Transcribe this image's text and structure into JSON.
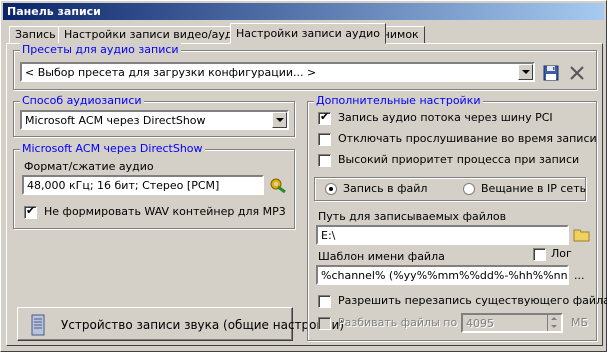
{
  "window": {
    "title": "Панель записи"
  },
  "tabs": [
    {
      "label": "Запись"
    },
    {
      "label": "Настройки записи видео/аудио"
    },
    {
      "label": "Настройки записи аудио"
    },
    {
      "label": "Снимок"
    }
  ],
  "presets": {
    "group_label": "Пресеты для аудио записи",
    "selected": "< Выбор пресета для загрузки конфигурации... >"
  },
  "audio_method": {
    "group_label": "Способ аудиозаписи",
    "selected": "Microsoft ACM через DirectShow"
  },
  "acm": {
    "group_label": "Microsoft ACM через DirectShow",
    "format_label": "Формат/сжатие аудио",
    "format_value": "48,000 кГц; 16 бит; Стерео [PCM]",
    "no_wav_label": "Не формировать WAV контейнер для MP3",
    "no_wav_checked": true
  },
  "device_button": {
    "label": "Устройство записи звука (общие настройки)"
  },
  "extra": {
    "group_label": "Дополнительные настройки",
    "pci_label": "Запись аудио потока через шину PCI",
    "pci_checked": true,
    "mute_label": "Отключать прослушивание во время записи",
    "mute_checked": false,
    "priority_label": "Высокий приоритет процесса при записи",
    "priority_checked": false,
    "radio_file_label": "Запись в файл",
    "radio_ip_label": "Вещание в IP сеть",
    "radio_selected": "file",
    "path_label": "Путь для записываемых файлов",
    "path_value": "E:\\",
    "template_label": "Шаблон имени файла",
    "log_label": "Лог",
    "log_checked": false,
    "template_value": "%channel% (%yy%%mm%%dd%-%hh%%nn%",
    "ellipsis_label": "...",
    "overwrite_label": "Разрешить перезапись существующего файла",
    "overwrite_checked": false,
    "split_label": "Разбивать файлы по",
    "split_value": "4095",
    "split_unit": "МБ"
  },
  "colors": {
    "title_start": "#0a246a",
    "title_end": "#a6caf0",
    "group_label": "#0000ff",
    "face": "#d4d0c8"
  }
}
